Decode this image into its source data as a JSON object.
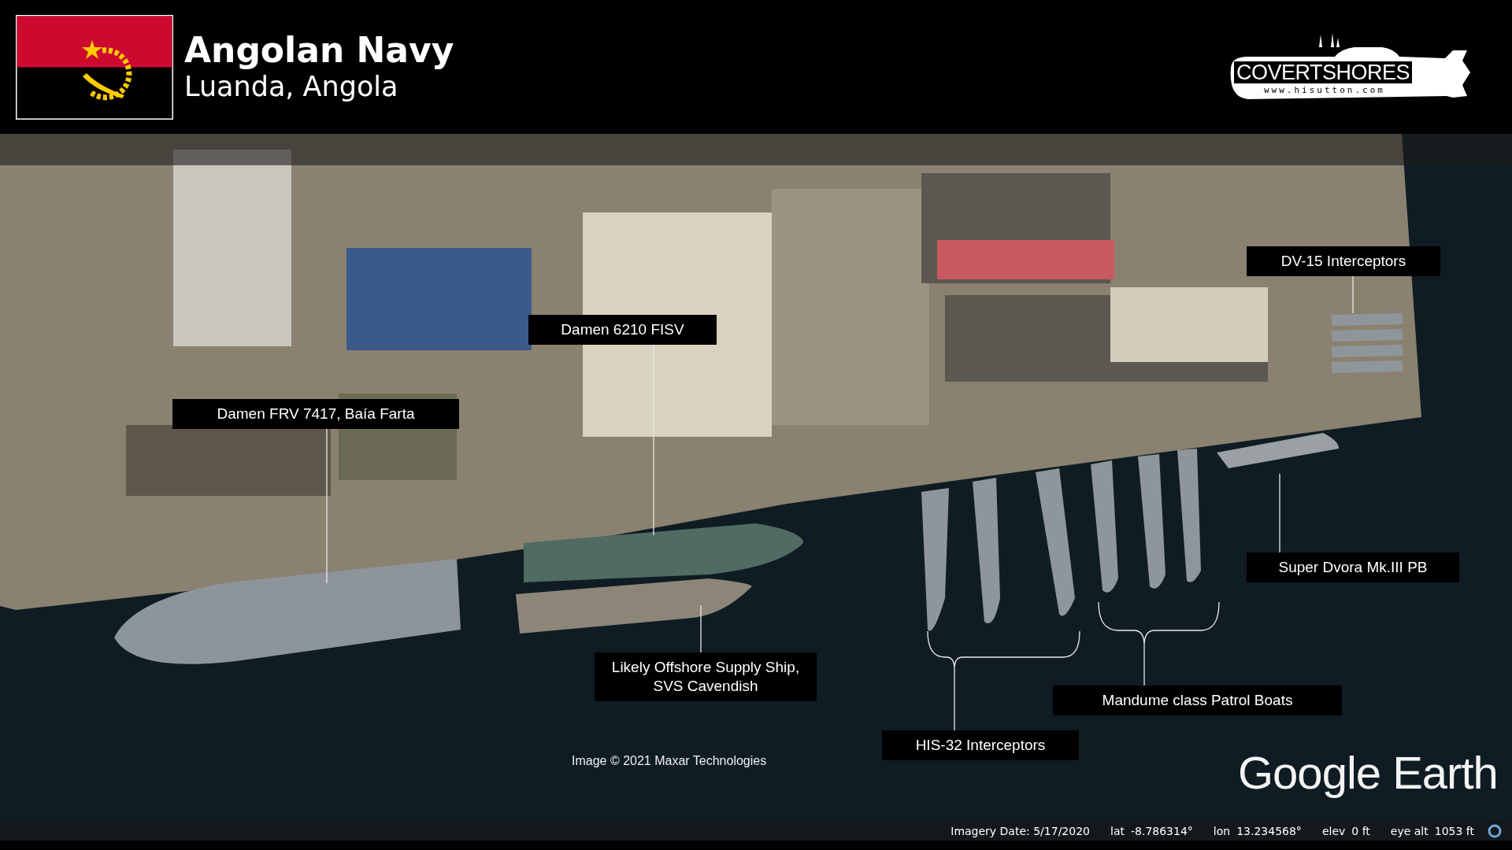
{
  "header": {
    "title": "Angolan Navy",
    "subtitle": "Luanda, Angola"
  },
  "logo": {
    "name": "COVERTSHORES",
    "url": "www.hisutton.com"
  },
  "annotations": [
    {
      "label": "DV-15 Interceptors"
    },
    {
      "label": "Damen 6210  FISV"
    },
    {
      "label": "Damen FRV 7417, Baía Farta"
    },
    {
      "label": "Likely Offshore Supply Ship, SVS Cavendish"
    },
    {
      "label": "Super Dvora Mk.III PB"
    },
    {
      "label": "Mandume class Patrol Boats"
    },
    {
      "label": "HIS-32 Interceptors"
    }
  ],
  "credit": "Image © 2021 Maxar Technologies",
  "brand": "Google Earth",
  "status_bar": [
    {
      "kind": "value",
      "text": "Imagery Date: 5/17/2020"
    },
    {
      "kind": "label",
      "text": "lat"
    },
    {
      "kind": "value",
      "text": "-8.786314°"
    },
    {
      "kind": "label",
      "text": "lon"
    },
    {
      "kind": "value",
      "text": "13.234568°"
    },
    {
      "kind": "label",
      "text": "elev"
    },
    {
      "kind": "value",
      "text": "0 ft"
    },
    {
      "kind": "label",
      "text": "eye alt"
    },
    {
      "kind": "value",
      "text": "1053 ft"
    }
  ]
}
